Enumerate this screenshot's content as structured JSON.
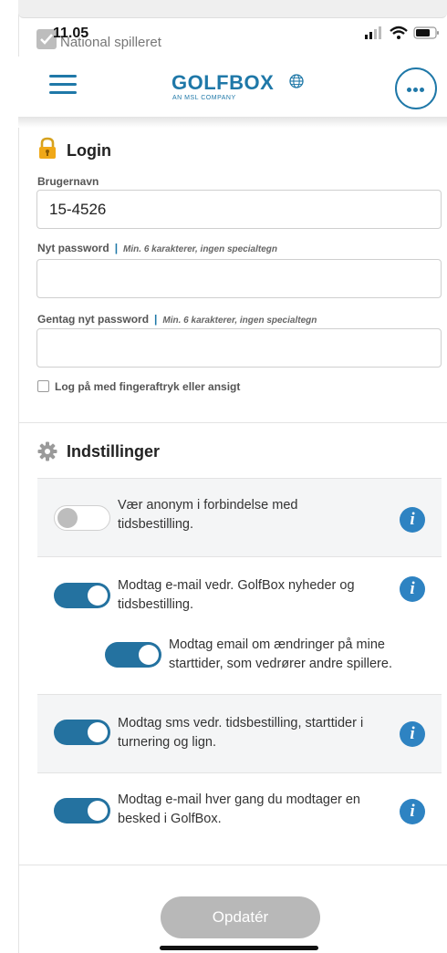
{
  "status_bar": {
    "time": "11.05"
  },
  "ghost": {
    "checkbox_label": "National spilleret"
  },
  "header": {
    "logo_text": "GOLFBOX",
    "logo_subtitle": "AN MSL COMPANY"
  },
  "login": {
    "title": "Login",
    "username_label": "Brugernavn",
    "username_value": "15-4526",
    "new_password_label": "Nyt password",
    "new_password_hint": "Min. 6 karakterer, ingen specialtegn",
    "new_password_value": "",
    "repeat_password_label": "Gentag nyt password",
    "repeat_password_hint": "Min. 6 karakterer, ingen specialtegn",
    "repeat_password_value": "",
    "fingerprint_label": "Log på med fingeraftryk eller ansigt",
    "fingerprint_checked": false
  },
  "settings": {
    "title": "Indstillinger",
    "rows": [
      {
        "line1": "Vær anonym i forbindelse med",
        "line2": "tidsbestilling.",
        "enabled": false
      },
      {
        "line1": "Modtag e-mail vedr. GolfBox nyheder og",
        "line2": "tidsbestilling.",
        "enabled": true
      },
      {
        "line1": "Modtag email om ændringer på mine",
        "line2": "starttider, som vedrører andre spillere.",
        "enabled": true
      },
      {
        "line1": "Modtag sms vedr. tidsbestilling, starttider i",
        "line2": "turnering og lign.",
        "enabled": true
      },
      {
        "line1": "Modtag e-mail hver gang du modtager en",
        "line2": "besked i GolfBox.",
        "enabled": true
      }
    ],
    "info_glyph": "i"
  },
  "actions": {
    "update_label": "Opdatér"
  },
  "colors": {
    "accent": "#1f78a8",
    "toggle_on": "#2472a0",
    "info": "#2e83c2",
    "button_disabled": "#b8b8b8"
  }
}
